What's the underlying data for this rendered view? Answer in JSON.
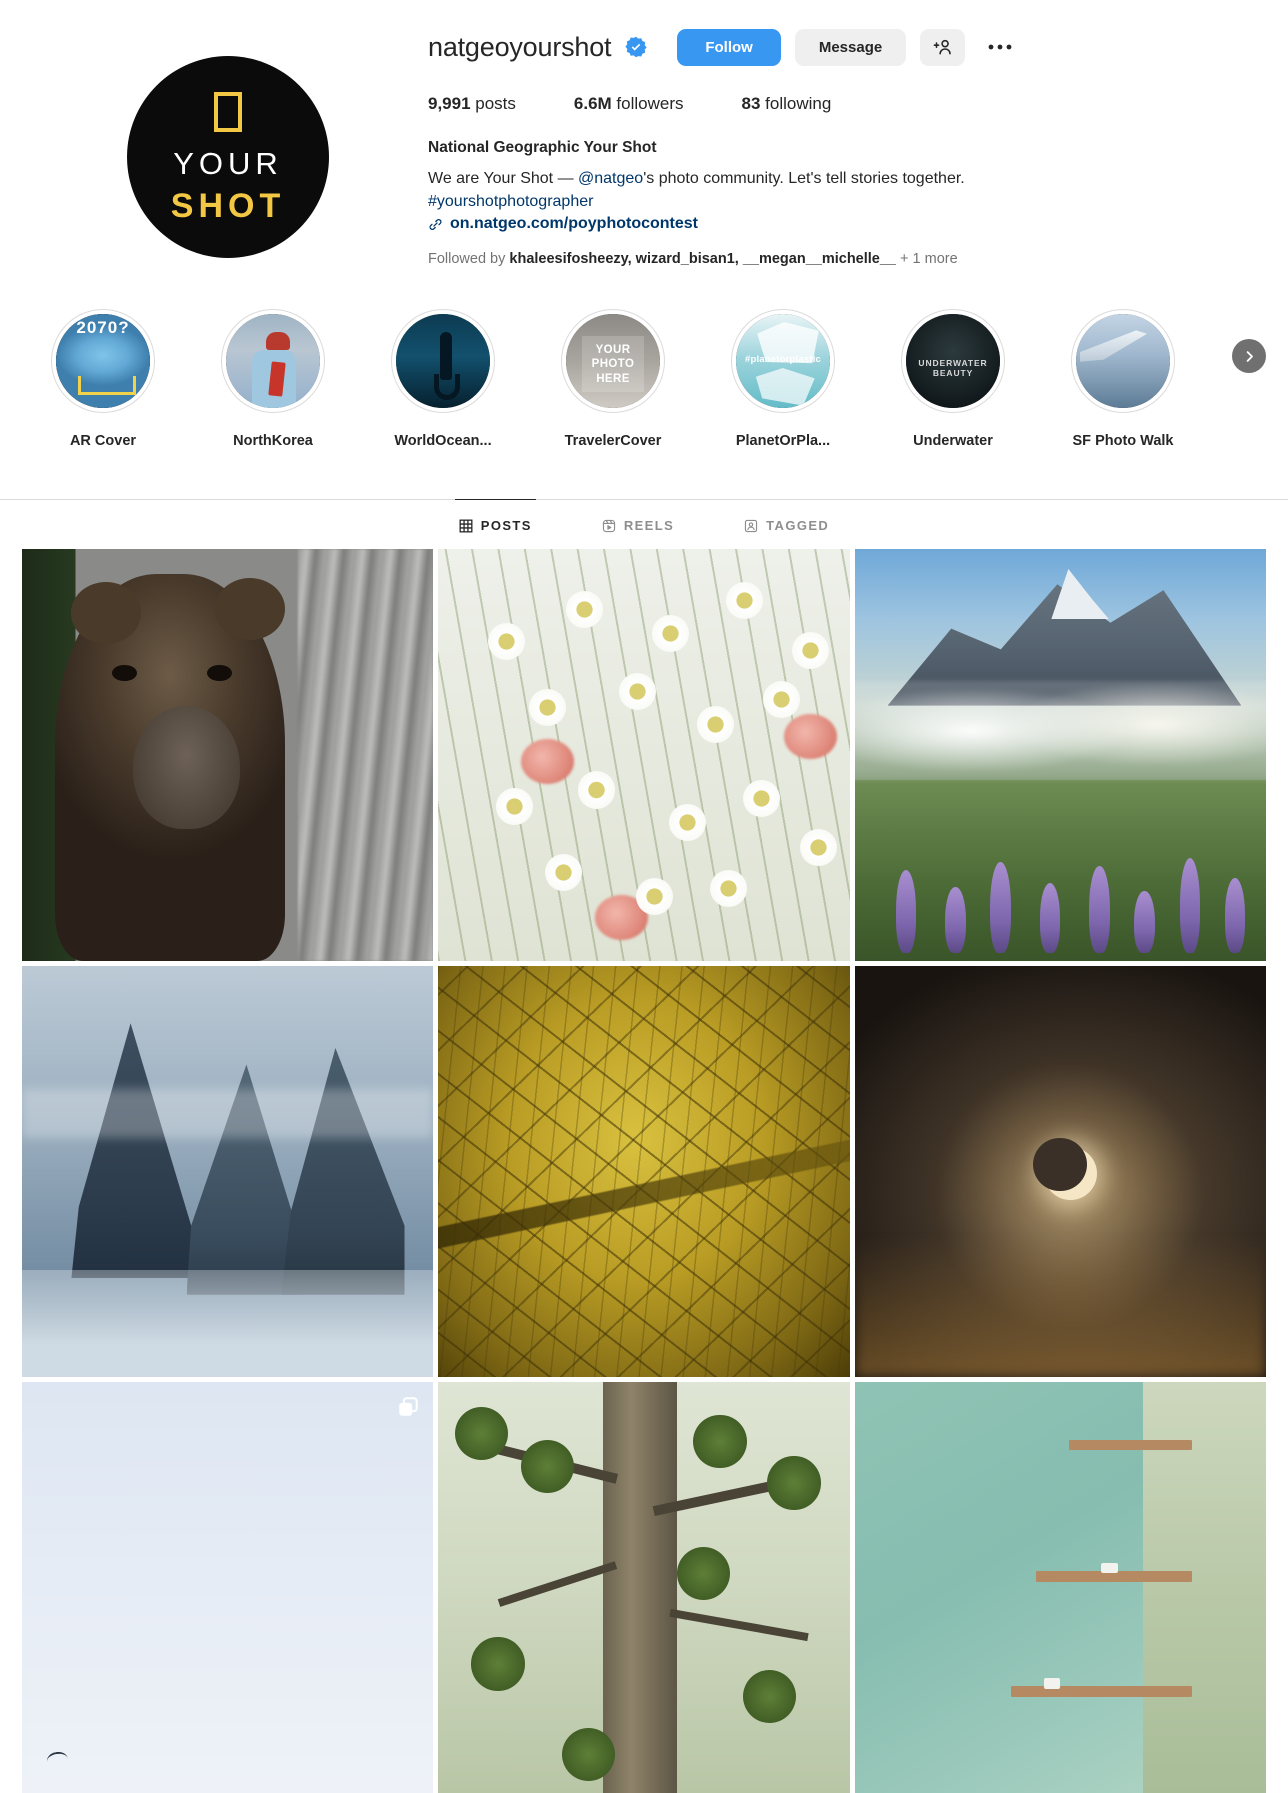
{
  "profile": {
    "username": "natgeoyourshot",
    "verified_label": "verified-badge",
    "full_name": "National Geographic Your Shot",
    "bio_line1_a": "We are Your Shot — ",
    "bio_mention": "@natgeo",
    "bio_line1_b": "'s photo community. Let's tell stories together.",
    "bio_hashtag": "#yourshotphotographer",
    "link": "on.natgeo.com/poyphotocontest",
    "followed_by_prefix": "Followed by ",
    "followed_by_names": "khaleesifosheezy, wizard_bisan1, __megan__michelle__",
    "followed_by_more": " + 1 more",
    "avatar": {
      "word_top": "YOUR",
      "word_bottom": "SHOT",
      "bg_color": "#0b0b0b",
      "accent_color": "#f2c744"
    }
  },
  "actions": {
    "follow_label": "Follow",
    "message_label": "Message",
    "add_person_icon": "person-add-icon",
    "more_options_icon": "more-options-icon",
    "follow_color": "#3897f0",
    "secondary_color": "#efefef"
  },
  "stats": [
    {
      "value": "9,991",
      "label": " posts"
    },
    {
      "value": "6.6M",
      "label": " followers"
    },
    {
      "value": "83",
      "label": " following"
    }
  ],
  "highlights": [
    {
      "label": "AR Cover",
      "thumb": "globe-2070-cover",
      "badge": "2070?"
    },
    {
      "label": "NorthKorea",
      "thumb": "north-korea-child"
    },
    {
      "label": "WorldOcean...",
      "thumb": "freediver-silhouette"
    },
    {
      "label": "TravelerCover",
      "thumb": "your-photo-here",
      "badge_lines": [
        "YOUR",
        "PHOTO",
        "HERE"
      ]
    },
    {
      "label": "PlanetOrPla...",
      "thumb": "plastic-bag-ocean",
      "badge": "#planetorplastic"
    },
    {
      "label": "Underwater",
      "thumb": "underwater-beauty",
      "badge": "UNDERWATER BEAUTY"
    },
    {
      "label": "SF Photo Walk",
      "thumb": "airplane-wing"
    }
  ],
  "highlights_next_icon": "chevron-right-icon",
  "tabs": [
    {
      "label": "POSTS",
      "icon": "grid-icon",
      "active": true
    },
    {
      "label": "REELS",
      "icon": "reels-icon",
      "active": false
    },
    {
      "label": "TAGGED",
      "icon": "tagged-icon",
      "active": false
    }
  ],
  "grid": [
    {
      "name": "post-brown-bear",
      "art": "p-bear",
      "carousel": false
    },
    {
      "name": "post-white-daisies",
      "art": "p-daisy",
      "carousel": false
    },
    {
      "name": "post-mountain-wildflowers",
      "art": "p-mtn",
      "carousel": false
    },
    {
      "name": "post-torres-del-paine",
      "art": "p-torres",
      "carousel": false
    },
    {
      "name": "post-golden-leaf-macro",
      "art": "p-leaf",
      "carousel": false
    },
    {
      "name": "post-solar-eclipse",
      "art": "p-ecl",
      "carousel": false
    },
    {
      "name": "post-pale-sky",
      "art": "p-sky",
      "carousel": true
    },
    {
      "name": "post-tree-canopy",
      "art": "p-tree",
      "carousel": false
    },
    {
      "name": "post-aerial-docks",
      "art": "p-aerial",
      "carousel": false
    }
  ]
}
